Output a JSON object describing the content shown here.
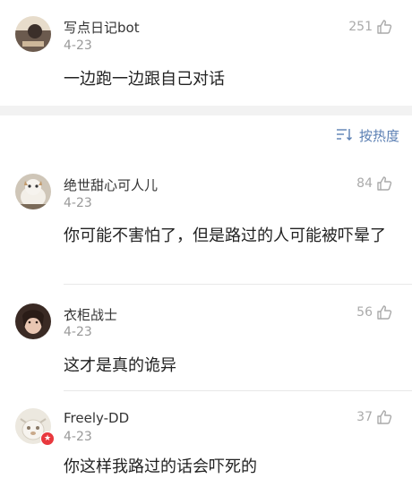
{
  "top_comment": {
    "author": "写点日记bot",
    "date": "4-23",
    "text": "一边跑一边跟自己对话",
    "likes": "251",
    "avatar_colors": [
      "#6b5a4e",
      "#e7dccb"
    ]
  },
  "sort_bar": {
    "label": "按热度",
    "accent": "#5b7fb3"
  },
  "comments": [
    {
      "author": "绝世甜心可人儿",
      "date": "4-23",
      "text": "你可能不害怕了，但是路过的人可能被吓晕了",
      "likes": "84"
    },
    {
      "author": "衣柜战士",
      "date": "4-23",
      "text": "这才是真的诡异",
      "likes": "56"
    },
    {
      "author": "Freely-DD",
      "date": "4-23",
      "text": "你这样我路过的话会吓死的",
      "likes": "37",
      "badge_color": "#e8383d"
    }
  ],
  "colors": {
    "meta_gray": "#999999",
    "like_gray": "#aaaaaa",
    "divider": "#e8e8e8",
    "section_band": "#f2f2f2"
  },
  "icons": {
    "like": "thumbs-up-icon",
    "sort": "sort-lines-icon",
    "badge": "star-badge-icon"
  }
}
